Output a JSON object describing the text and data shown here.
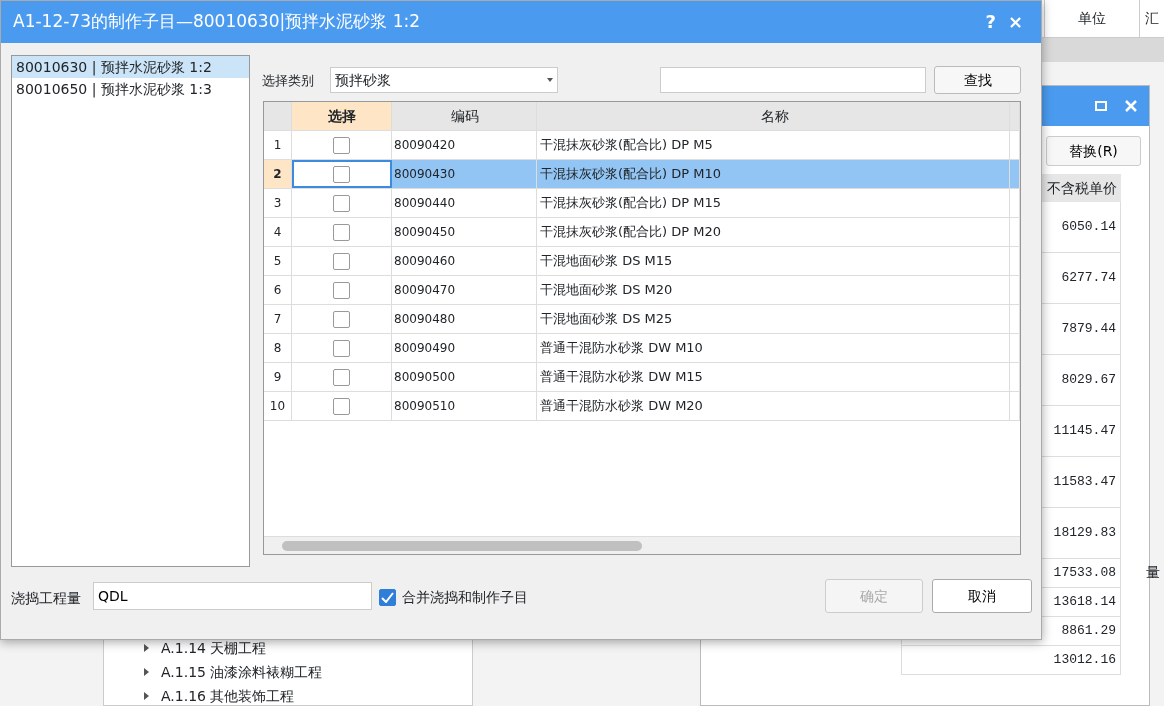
{
  "background_app": {
    "header_columns": [
      "单位",
      "汇"
    ],
    "tree_items": [
      "A.1.14 天棚工程",
      "A.1.15 油漆涂料裱糊工程",
      "A.1.16 其他装饰工程"
    ],
    "side_text": "量",
    "price_window": {
      "replace_button": "替换(R)",
      "price_column": "不含税单价",
      "prices": [
        {
          "value": "6050.14",
          "tall": true
        },
        {
          "value": "6277.74",
          "tall": true
        },
        {
          "value": "7879.44",
          "tall": true
        },
        {
          "value": "8029.67",
          "tall": true
        },
        {
          "value": "11145.47",
          "tall": true
        },
        {
          "value": "11583.47",
          "tall": true
        },
        {
          "value": "18129.83",
          "tall": true
        },
        {
          "value": "17533.08",
          "tall": false
        },
        {
          "value": "13618.14",
          "tall": false
        },
        {
          "value": "8861.29",
          "tall": false
        },
        {
          "value": "13012.16",
          "tall": false
        }
      ]
    }
  },
  "dialog": {
    "title": "A1-12-73的制作子目—80010630|预拌水泥砂浆 1:2",
    "help": "?",
    "close": "×",
    "left_list": [
      {
        "label": "80010630 | 预拌水泥砂浆 1:2",
        "selected": true
      },
      {
        "label": "80010650 | 预拌水泥砂浆 1:3",
        "selected": false
      }
    ],
    "category_label": "选择类别",
    "category_value": "预拌砂浆",
    "search_button": "查找",
    "table": {
      "columns": [
        "选择",
        "编码",
        "名称"
      ],
      "rows": [
        {
          "index": "1",
          "checked": false,
          "selected": false,
          "code": "80090420",
          "name": "干混抹灰砂浆(配合比) DP M5"
        },
        {
          "index": "2",
          "checked": false,
          "selected": true,
          "code": "80090430",
          "name": "干混抹灰砂浆(配合比) DP M10"
        },
        {
          "index": "3",
          "checked": false,
          "selected": false,
          "code": "80090440",
          "name": "干混抹灰砂浆(配合比) DP M15"
        },
        {
          "index": "4",
          "checked": false,
          "selected": false,
          "code": "80090450",
          "name": "干混抹灰砂浆(配合比) DP M20"
        },
        {
          "index": "5",
          "checked": false,
          "selected": false,
          "code": "80090460",
          "name": "干混地面砂浆 DS M15"
        },
        {
          "index": "6",
          "checked": false,
          "selected": false,
          "code": "80090470",
          "name": "干混地面砂浆 DS M20"
        },
        {
          "index": "7",
          "checked": false,
          "selected": false,
          "code": "80090480",
          "name": "干混地面砂浆 DS M25"
        },
        {
          "index": "8",
          "checked": false,
          "selected": false,
          "code": "80090490",
          "name": "普通干混防水砂浆 DW M10"
        },
        {
          "index": "9",
          "checked": false,
          "selected": false,
          "code": "80090500",
          "name": "普通干混防水砂浆 DW M15"
        },
        {
          "index": "10",
          "checked": false,
          "selected": false,
          "code": "80090510",
          "name": "普通干混防水砂浆 DW M20"
        }
      ]
    },
    "quantity_label": "浇捣工程量",
    "quantity_value": "QDL",
    "merge_checkbox": {
      "label": "合并浇捣和制作子目",
      "checked": true
    },
    "ok_button": {
      "label": "确定",
      "disabled": true
    },
    "cancel_button": "取消"
  }
}
